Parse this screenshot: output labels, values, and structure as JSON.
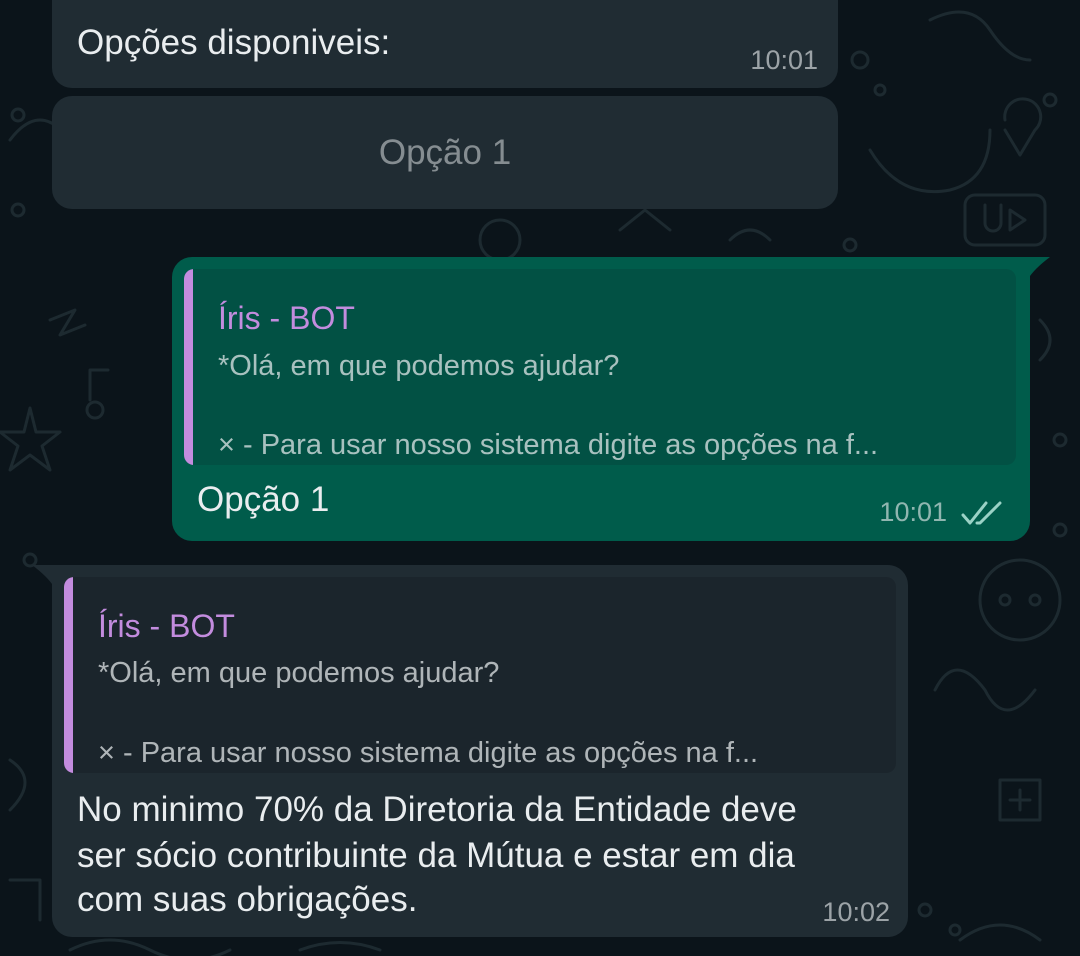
{
  "colors": {
    "background": "#0b141a",
    "bubble_incoming": "#202c33",
    "bubble_outgoing": "#005c4b",
    "quote_outgoing_bg": "#025144",
    "quote_incoming_bg": "#1b252c",
    "quote_accent": "#c38cde",
    "read_ticks": "#9ad2c6"
  },
  "messages": {
    "options_header": {
      "text": "Opções disponiveis:",
      "time": "10:01"
    },
    "option_button": {
      "label": "Opção 1"
    },
    "reply_out": {
      "quote_author": "Íris - BOT",
      "quote_line1": "*Olá, em que podemos ajudar?",
      "quote_line2": "× - Para usar nosso sistema digite as opções na f...",
      "text": "Opção 1",
      "time": "10:01",
      "status_icon": "double-check-icon"
    },
    "reply_in": {
      "quote_author": "Íris - BOT",
      "quote_line1": "*Olá, em que podemos ajudar?",
      "quote_line2": "× - Para usar nosso sistema digite as opções na f...",
      "text_line1": "No minimo 70% da Diretoria da Entidade deve",
      "text_line2": "ser sócio contribuinte da Mútua e estar em dia",
      "text_line3": "com suas obrigações.",
      "time": "10:02"
    }
  }
}
